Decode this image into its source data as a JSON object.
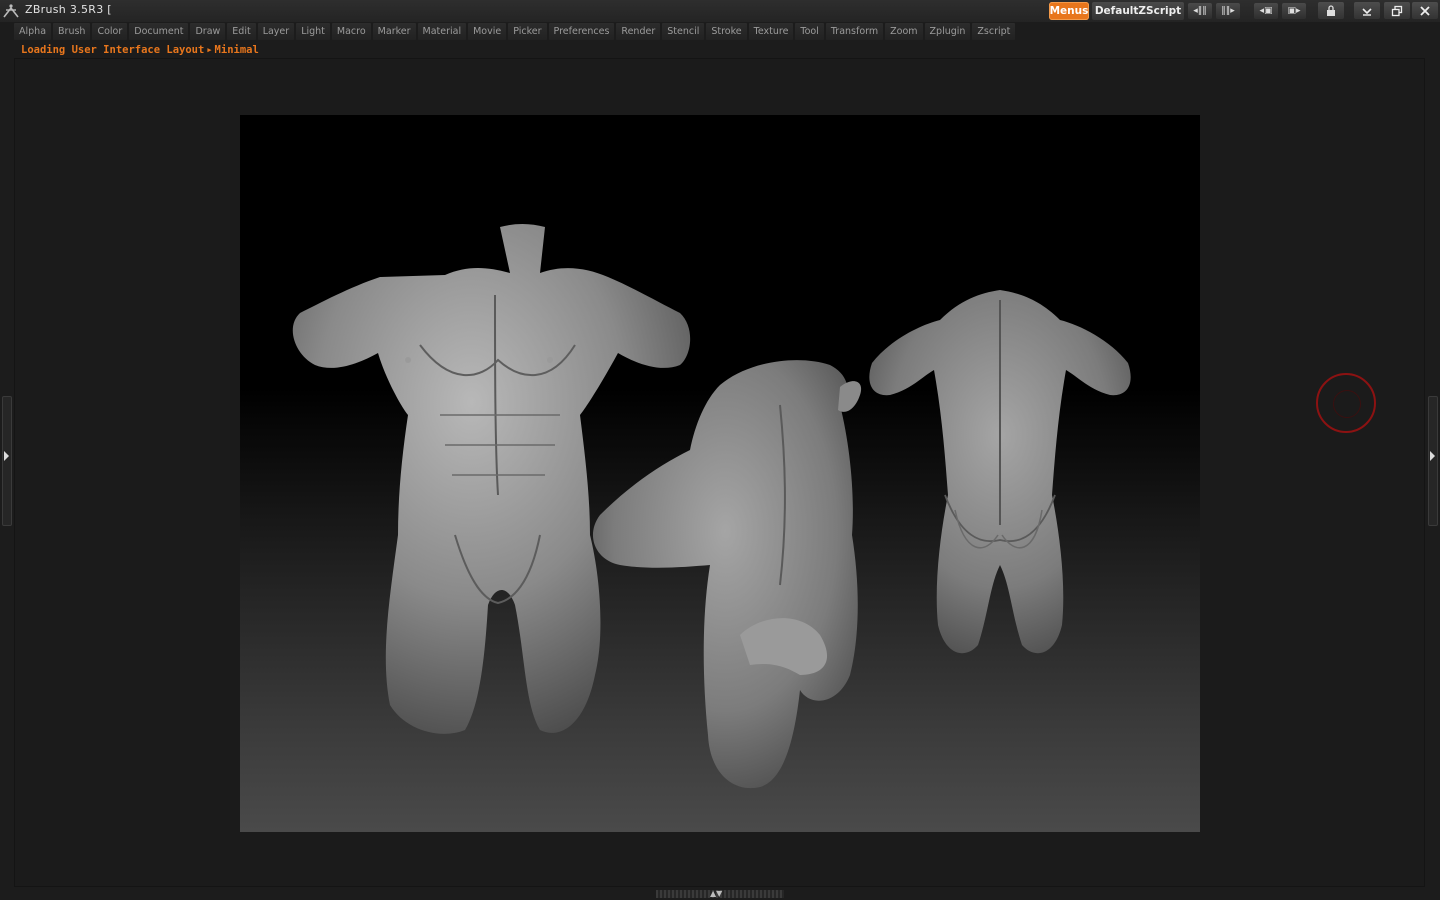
{
  "app": {
    "title": "ZBrush 3.5R3  ["
  },
  "titlebar": {
    "menus_label": "Menus",
    "script_label": "DefaultZScript"
  },
  "menu": {
    "items": [
      "Alpha",
      "Brush",
      "Color",
      "Document",
      "Draw",
      "Edit",
      "Layer",
      "Light",
      "Macro",
      "Marker",
      "Material",
      "Movie",
      "Picker",
      "Preferences",
      "Render",
      "Stencil",
      "Stroke",
      "Texture",
      "Tool",
      "Transform",
      "Zoom",
      "Zplugin",
      "Zscript"
    ]
  },
  "status": {
    "text": "Loading User Interface Layout",
    "sub": "Minimal"
  },
  "colors": {
    "accent": "#e8761c",
    "cursor": "#8c1212",
    "model": "#8a8a8a"
  }
}
